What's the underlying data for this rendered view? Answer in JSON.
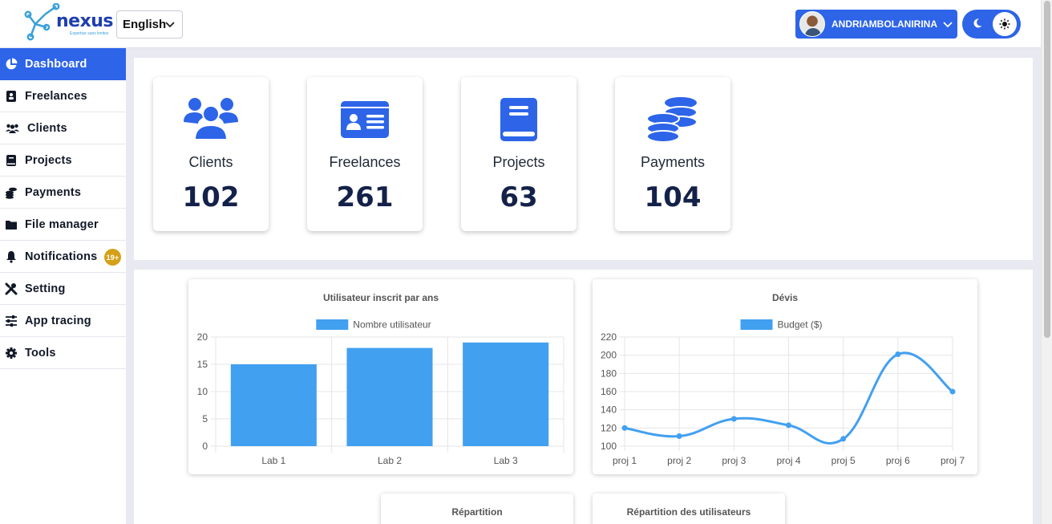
{
  "header": {
    "logo_text": "nexus",
    "logo_tagline": "Expertise sans limites",
    "language": "English",
    "user_name": "ANDRIAMBOLANIRINA"
  },
  "sidebar": {
    "items": [
      {
        "label": "Dashboard",
        "icon": "chart-pie-icon",
        "active": true
      },
      {
        "label": "Freelances",
        "icon": "id-badge-icon"
      },
      {
        "label": "Clients",
        "icon": "users-icon"
      },
      {
        "label": "Projects",
        "icon": "book-icon"
      },
      {
        "label": "Payments",
        "icon": "coins-icon"
      },
      {
        "label": "File manager",
        "icon": "folder-icon"
      },
      {
        "label": "Notifications",
        "icon": "bell-icon",
        "badge": "19+"
      },
      {
        "label": "Setting",
        "icon": "tools-icon"
      },
      {
        "label": "App tracing",
        "icon": "sliders-icon"
      },
      {
        "label": "Tools",
        "icon": "gear-icon"
      }
    ]
  },
  "stats": [
    {
      "label": "Clients",
      "value": "102",
      "icon": "users-icon"
    },
    {
      "label": "Freelances",
      "value": "261",
      "icon": "id-card-icon"
    },
    {
      "label": "Projects",
      "value": "63",
      "icon": "book-icon"
    },
    {
      "label": "Payments",
      "value": "104",
      "icon": "coins-icon"
    }
  ],
  "colors": {
    "primary": "#2d64e8",
    "chart_blue": "#42a0f0",
    "badge": "#d4a017",
    "stat_value": "#14224a"
  },
  "chart_data": [
    {
      "type": "bar",
      "title": "Utilisateur inscrit par ans",
      "categories": [
        "Lab 1",
        "Lab 2",
        "Lab 3"
      ],
      "series": [
        {
          "name": "Nombre utilisateur",
          "values": [
            15,
            18,
            19
          ]
        }
      ],
      "ylim": [
        0,
        20
      ],
      "yticks": [
        0,
        5,
        10,
        15,
        20
      ],
      "legend": "top",
      "grid": true
    },
    {
      "type": "line",
      "title": "Dévis",
      "categories": [
        "proj 1",
        "proj 2",
        "proj 3",
        "proj 4",
        "proj 5",
        "proj 6",
        "proj 7"
      ],
      "series": [
        {
          "name": "Budget ($)",
          "values": [
            120,
            111,
            130,
            123,
            108,
            201,
            160
          ]
        }
      ],
      "ylim": [
        100,
        220
      ],
      "yticks": [
        100,
        120,
        140,
        160,
        180,
        200,
        220
      ],
      "legend": "top",
      "grid": true
    }
  ],
  "bottom_cards": {
    "left_title": "Répartition",
    "right_title": "Répartition des utilisateurs"
  }
}
